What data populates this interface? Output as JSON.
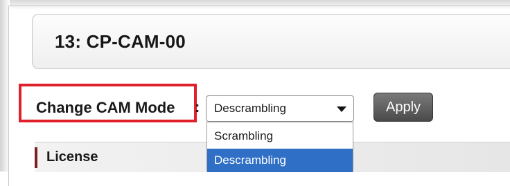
{
  "header": {
    "title": "13: CP-CAM-00"
  },
  "cam_mode": {
    "label": "Change CAM Mode",
    "separator": ":",
    "selected": "Descrambling",
    "options": [
      "Scrambling",
      "Descrambling"
    ],
    "highlighted_option": "Descrambling",
    "apply_label": "Apply"
  },
  "sections": {
    "license_label": "License"
  },
  "colors": {
    "highlight_border": "#e0202a",
    "selected_option_bg": "#2f6fc6",
    "apply_button_bg": "#5a5a5a",
    "section_accent": "#7a2020"
  },
  "icons": {
    "select_arrow": "chevron-down-icon"
  }
}
